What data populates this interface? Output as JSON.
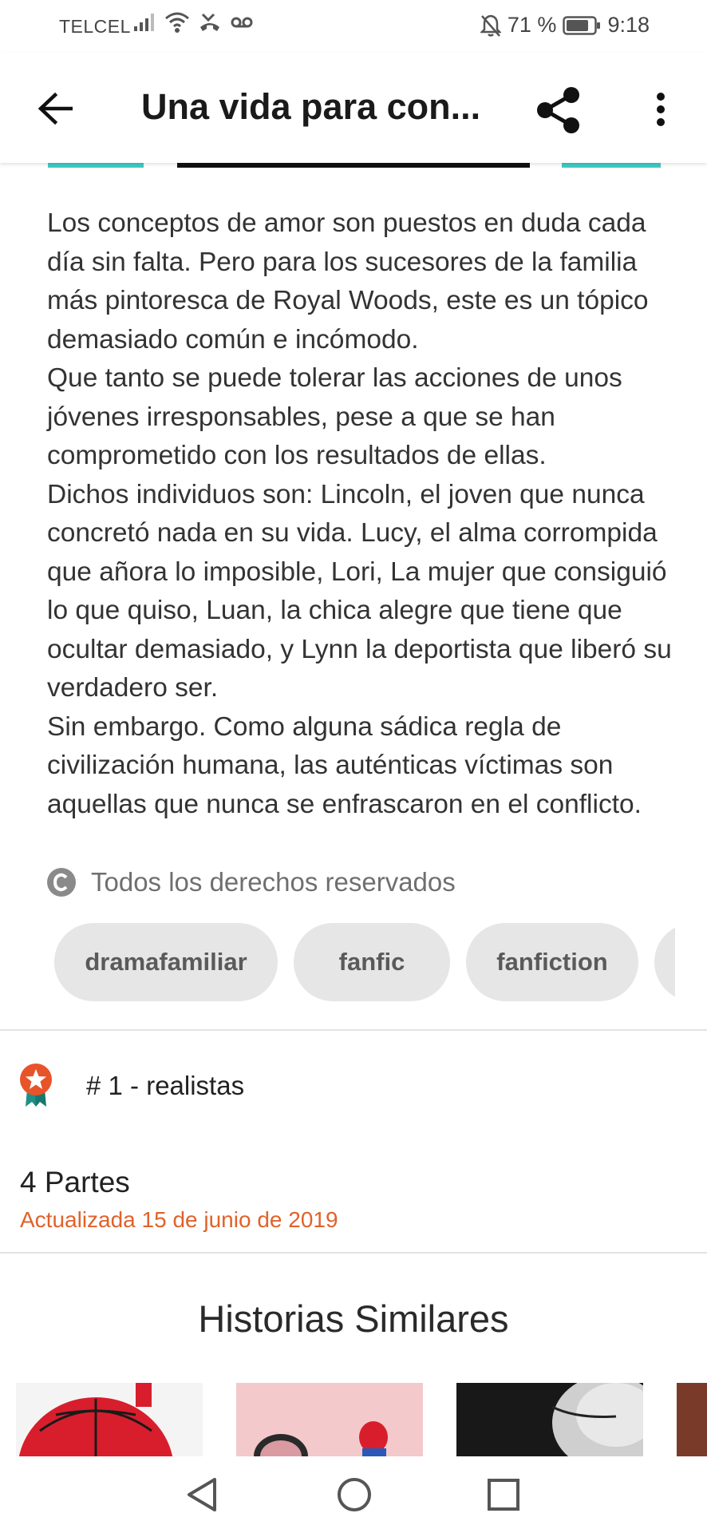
{
  "status_bar": {
    "carrier": "TELCEL",
    "battery": "71 %",
    "time": "9:18",
    "icons": [
      "signal-icon",
      "wifi-icon",
      "missed-call-icon",
      "voicemail-icon",
      "mute-bell-icon",
      "battery-icon"
    ]
  },
  "app_bar": {
    "title": "Una vida para con...",
    "back_icon": "arrow-back-icon",
    "share_icon": "share-icon",
    "more_icon": "more-vert-icon"
  },
  "story": {
    "description": "Los conceptos de amor son puestos en duda cada día sin falta. Pero para los sucesores de la familia más pintoresca de Royal Woods, este es un tópico demasiado común e incómodo.\nQue tanto se puede tolerar las acciones de unos jóvenes irresponsables, pese a que se han comprometido con los resultados de ellas.\nDichos individuos son:  Lincoln, el joven que nunca concretó nada en su vida. Lucy, el alma corrompida que añora lo imposible, Lori, La mujer que consiguió lo que quiso, Luan, la chica alegre que tiene que ocultar demasiado, y Lynn la deportista que liberó su verdadero ser.\nSin embargo. Como alguna sádica regla de civilización humana, las auténticas víctimas son aquellas que nunca se enfrascaron en el conflicto.",
    "copyright": "Todos los derechos reservados",
    "tags": [
      "dramafamiliar",
      "fanfic",
      "fanfiction"
    ],
    "ranking": "# 1 - realistas",
    "parts": "4 Partes",
    "updated": "Actualizada 15 de junio de 2019"
  },
  "similar": {
    "title": "Historias Similares"
  },
  "colors": {
    "accent": "#e0622a",
    "tag_bg": "#e6e6e6",
    "cover_teal": "#3fc9c4"
  }
}
